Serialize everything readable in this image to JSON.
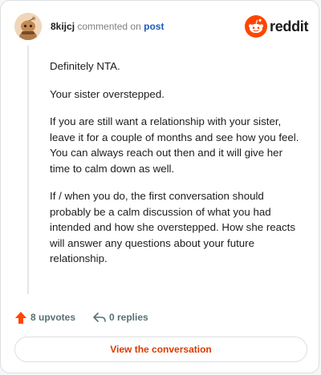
{
  "comment": {
    "username": "8kijcj",
    "action_text": "commented on",
    "target_link": "post",
    "brand": "reddit",
    "paragraphs": [
      "Definitely NTA.",
      "Your sister overstepped.",
      "If you are still want a relationship with your sister, leave it for a couple of months and see how you feel. You can always reach out then and it will give her time to calm down as well.",
      "If / when you do, the first conversation should probably be a calm discussion of what you had intended and how she overstepped. How she reacts will answer any questions about your future relationship."
    ]
  },
  "footer": {
    "upvotes_label": "8 upvotes",
    "replies_label": "0 replies",
    "view_button_label": "View the conversation"
  },
  "icons": {
    "avatar": "snoo-avatar-icon",
    "logo": "reddit-logo-icon",
    "upvote": "upvote-arrow-icon",
    "reply": "reply-arrow-icon"
  },
  "colors": {
    "brand_orange": "#ff4500",
    "link_blue": "#1a5ab8",
    "button_text": "#d93a00",
    "muted": "#576f76"
  }
}
